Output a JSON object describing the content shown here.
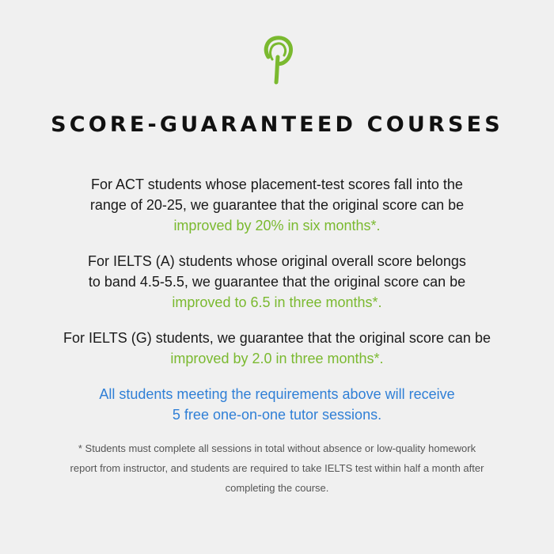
{
  "brand": {
    "logo_icon": "leaf-key-icon",
    "accent_color": "#7ab92f",
    "link_color": "#2f7fd6"
  },
  "title": "SCORE-GUARANTEED COURSES",
  "act": {
    "line1": "For ACT students whose placement-test scores fall into the",
    "line2": "range of 20-25, we guarantee that the original score can be",
    "highlight": "improved by 20% in six months*."
  },
  "ielts_a": {
    "line1": "For IELTS (A) students whose original overall score belongs",
    "line2": "to band 4.5-5.5, we guarantee that the original score can be",
    "highlight": "improved to 6.5 in three months*."
  },
  "ielts_g": {
    "line1": "For IELTS (G) students, we guarantee that the original score can be",
    "highlight": "improved by 2.0 in three months*."
  },
  "bonus": {
    "line1": "All students meeting the requirements above will receive",
    "line2": "5 free one-on-one tutor sessions."
  },
  "footnote": {
    "line1": "* Students must complete all sessions in total without absence or low-quality homework",
    "line2": "report from instructor, and students are required to take IELTS test within half a month after",
    "line3": "completing the course."
  }
}
